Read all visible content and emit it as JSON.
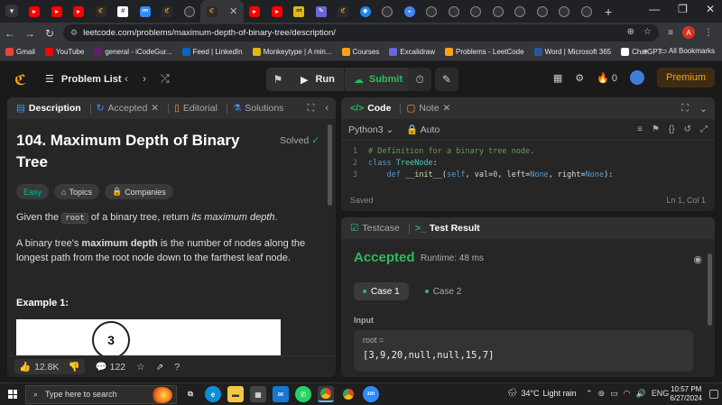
{
  "browser": {
    "url": "leetcode.com/problems/maximum-depth-of-binary-tree/description/",
    "profile_initial": "A",
    "tabs": [
      {
        "icon": "yt"
      },
      {
        "icon": "yt"
      },
      {
        "icon": "yt"
      },
      {
        "icon": "lc"
      },
      {
        "icon": "sl"
      },
      {
        "icon": "zm"
      },
      {
        "icon": "lc"
      },
      {
        "icon": "gh"
      },
      {
        "icon": "active-lc"
      },
      {
        "icon": "yt"
      },
      {
        "icon": "yt"
      },
      {
        "icon": "mt"
      },
      {
        "icon": "ex"
      },
      {
        "icon": "lc"
      },
      {
        "icon": "pp"
      },
      {
        "icon": "gh"
      },
      {
        "icon": "qb"
      },
      {
        "icon": "gh"
      },
      {
        "icon": "gh"
      },
      {
        "icon": "gh"
      },
      {
        "icon": "gh"
      },
      {
        "icon": "gh"
      },
      {
        "icon": "gh"
      },
      {
        "icon": "gh"
      },
      {
        "icon": "gh"
      }
    ],
    "bookmarks": [
      {
        "label": "Gmail",
        "color": "#ea4335"
      },
      {
        "label": "YouTube",
        "color": "#ff0000"
      },
      {
        "label": "general - iCodeGur...",
        "color": "#611f69"
      },
      {
        "label": "Feed | LinkedIn",
        "color": "#0a66c2"
      },
      {
        "label": "Monkeytype | A min...",
        "color": "#e2b714"
      },
      {
        "label": "Courses",
        "color": "#ffa116"
      },
      {
        "label": "Excalidraw",
        "color": "#6965db"
      },
      {
        "label": "Problems - LeetCode",
        "color": "#ffa116"
      },
      {
        "label": "Word | Microsoft 365",
        "color": "#2b579a"
      },
      {
        "label": "ChatGPT",
        "color": "#ffffff"
      }
    ],
    "all_bookmarks": "All Bookmarks"
  },
  "nav": {
    "problem_list": "Problem List",
    "run": "Run",
    "submit": "Submit",
    "streak": "0",
    "premium": "Premium"
  },
  "description": {
    "tabs": [
      "Description",
      "Accepted",
      "Editorial",
      "Solutions"
    ],
    "title": "104. Maximum Depth of Binary Tree",
    "solved": "Solved",
    "tag_easy": "Easy",
    "tag_topics": "Topics",
    "tag_companies": "Companies",
    "p1_a": "Given the",
    "p1_code": "root",
    "p1_b": "of a binary tree, return",
    "p1_em": "its maximum depth",
    "p1_c": ".",
    "p2_a": "A binary tree's",
    "p2_strong": "maximum depth",
    "p2_b": "is the number of nodes along the longest path from the root node down to the farthest leaf node.",
    "example_title": "Example 1:",
    "tree_root": "3",
    "likes": "12.8K",
    "comments": "122"
  },
  "code": {
    "tabs": [
      "Code",
      "Note"
    ],
    "language": "Python3",
    "auto": "Auto",
    "lines": [
      {
        "n": "1",
        "t": "# Definition for a binary tree node."
      },
      {
        "n": "2",
        "t": "class TreeNode:"
      },
      {
        "n": "3",
        "t": "    def __init__(self, val=0, left=None, right=None):"
      }
    ],
    "saved": "Saved",
    "cursor": "Ln 1, Col 1"
  },
  "result": {
    "tabs": [
      "Testcase",
      "Test Result"
    ],
    "status": "Accepted",
    "runtime": "Runtime: 48 ms",
    "cases": [
      "Case 1",
      "Case 2"
    ],
    "input_label": "Input",
    "input_name": "root =",
    "input_value": "[3,9,20,null,null,15,7]"
  },
  "taskbar": {
    "search_placeholder": "Type here to search",
    "temp": "34°C",
    "weather": "Light rain",
    "time": "10:57 PM",
    "date": "6/27/2024"
  },
  "colors": {
    "accent": "#ffa116",
    "success": "#2cbb5d",
    "easy": "#00b8a3"
  }
}
